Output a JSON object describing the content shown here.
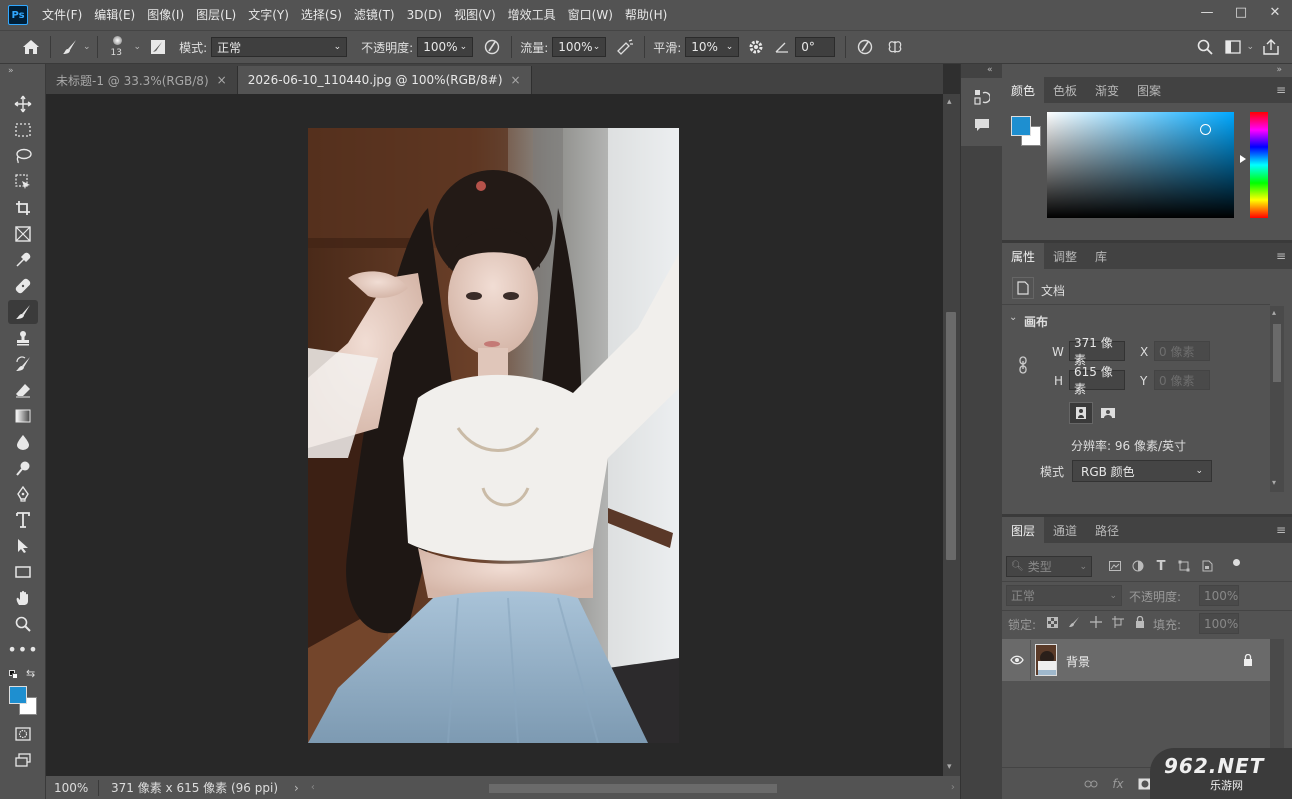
{
  "app": {
    "logo": "Ps"
  },
  "menu": [
    "文件(F)",
    "编辑(E)",
    "图像(I)",
    "图层(L)",
    "文字(Y)",
    "选择(S)",
    "滤镜(T)",
    "3D(D)",
    "视图(V)",
    "增效工具",
    "窗口(W)",
    "帮助(H)"
  ],
  "window_controls": {
    "minimize": "—",
    "maximize": "□",
    "close": "✕"
  },
  "options": {
    "brush_size": "13",
    "mode_label": "模式:",
    "mode_value": "正常",
    "opacity_label": "不透明度:",
    "opacity_value": "100%",
    "flow_label": "流量:",
    "flow_value": "100%",
    "smooth_label": "平滑:",
    "smooth_value": "10%",
    "angle_value": "0°"
  },
  "tabs": [
    {
      "label": "未标题-1 @ 33.3%(RGB/8)",
      "close": "×",
      "active": false
    },
    {
      "label": "2026-06-10_110440.jpg @ 100%(RGB/8#)",
      "close": "×",
      "active": true
    }
  ],
  "status": {
    "zoom": "100%",
    "doc_info": "371 像素 x 615 像素 (96 ppi)",
    "arrow": "›"
  },
  "color_panel": {
    "tabs": [
      "颜色",
      "色板",
      "渐变",
      "图案"
    ],
    "foreground": "#1e8fd0",
    "background": "#ffffff"
  },
  "properties_panel": {
    "tabs": [
      "属性",
      "调整",
      "库"
    ],
    "doc_label": "文档",
    "section": "画布",
    "w_label": "W",
    "w_value": "371 像素",
    "h_label": "H",
    "h_value": "615 像素",
    "x_label": "X",
    "x_value": "0 像素",
    "y_label": "Y",
    "y_value": "0 像素",
    "resolution": "分辨率: 96 像素/英寸",
    "mode_label": "模式",
    "mode_value": "RGB 颜色"
  },
  "layers_panel": {
    "tabs": [
      "图层",
      "通道",
      "路径"
    ],
    "filter_placeholder": "类型",
    "blend_mode": "正常",
    "opacity_label": "不透明度:",
    "opacity_value": "100%",
    "lock_label": "锁定:",
    "fill_label": "填充:",
    "fill_value": "100%",
    "layers": [
      {
        "name": "背景",
        "locked": true,
        "visible": true
      }
    ]
  },
  "watermark": {
    "text": "962.NET",
    "subtext": "乐游网"
  }
}
